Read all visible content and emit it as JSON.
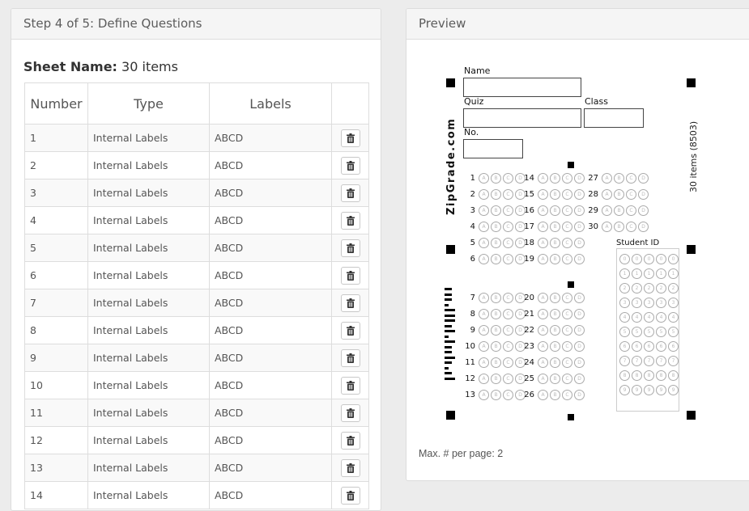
{
  "left_panel": {
    "title": "Step 4 of 5: Define Questions",
    "sheet_name_label": "Sheet Name:",
    "sheet_name_value": "30 items",
    "columns": [
      "Number",
      "Type",
      "Labels",
      ""
    ],
    "rows": [
      {
        "number": "1",
        "type": "Internal Labels",
        "labels": "ABCD"
      },
      {
        "number": "2",
        "type": "Internal Labels",
        "labels": "ABCD"
      },
      {
        "number": "3",
        "type": "Internal Labels",
        "labels": "ABCD"
      },
      {
        "number": "4",
        "type": "Internal Labels",
        "labels": "ABCD"
      },
      {
        "number": "5",
        "type": "Internal Labels",
        "labels": "ABCD"
      },
      {
        "number": "6",
        "type": "Internal Labels",
        "labels": "ABCD"
      },
      {
        "number": "7",
        "type": "Internal Labels",
        "labels": "ABCD"
      },
      {
        "number": "8",
        "type": "Internal Labels",
        "labels": "ABCD"
      },
      {
        "number": "9",
        "type": "Internal Labels",
        "labels": "ABCD"
      },
      {
        "number": "10",
        "type": "Internal Labels",
        "labels": "ABCD"
      },
      {
        "number": "11",
        "type": "Internal Labels",
        "labels": "ABCD"
      },
      {
        "number": "12",
        "type": "Internal Labels",
        "labels": "ABCD"
      },
      {
        "number": "13",
        "type": "Internal Labels",
        "labels": "ABCD"
      },
      {
        "number": "14",
        "type": "Internal Labels",
        "labels": "ABCD"
      }
    ],
    "delete_icon": "trash-icon"
  },
  "preview": {
    "title": "Preview",
    "name_label": "Name",
    "quiz_label": "Quiz",
    "class_label": "Class",
    "no_label": "No.",
    "brand": "ZipGrade.com",
    "sheet_info": "30 items (8503)",
    "student_id_label": "Student ID",
    "bubble_letters": [
      "A",
      "B",
      "C",
      "D"
    ],
    "id_digits": [
      "0",
      "1",
      "2",
      "3",
      "4",
      "5",
      "6",
      "7",
      "8",
      "9"
    ],
    "questions_col1": [
      "1",
      "2",
      "3",
      "4",
      "5",
      "6"
    ],
    "questions_col2": [
      "14",
      "15",
      "16",
      "17",
      "18",
      "19"
    ],
    "questions_col3": [
      "27",
      "28",
      "29",
      "30"
    ],
    "questions_col4": [
      "7",
      "8",
      "9",
      "10",
      "11",
      "12",
      "13"
    ],
    "questions_col5": [
      "20",
      "21",
      "22",
      "23",
      "24",
      "25",
      "26"
    ],
    "max_per_page": "Max. # per page: 2"
  }
}
